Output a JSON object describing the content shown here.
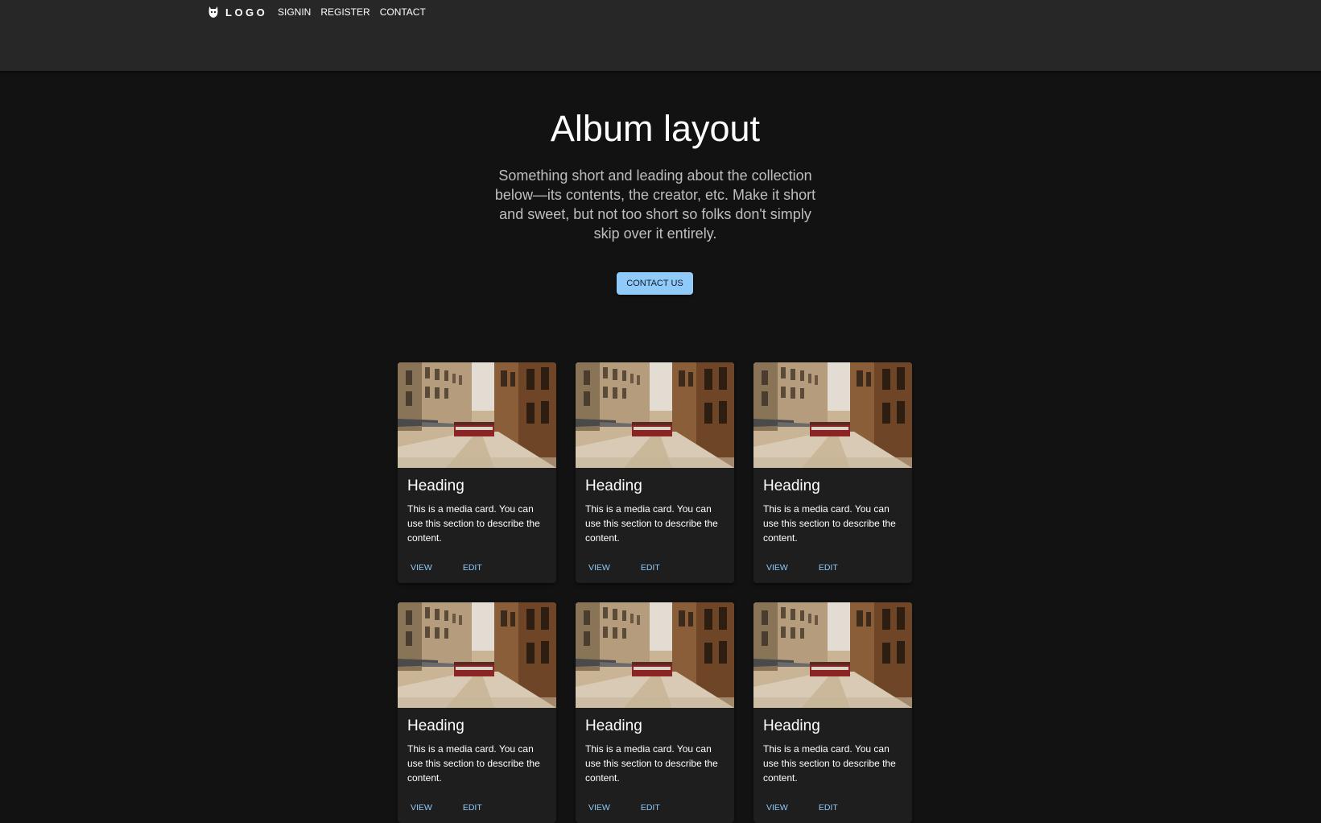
{
  "appbar": {
    "logo_text": "LOGO",
    "nav": [
      {
        "label": "SIGNIN"
      },
      {
        "label": "REGISTER"
      },
      {
        "label": "CONTACT"
      }
    ]
  },
  "hero": {
    "title": "Album layout",
    "subtitle": "Something short and leading about the collection below—its contents, the creator, etc. Make it short and sweet, but not too short so folks don't simply skip over it entirely.",
    "button_label": "CONTACT US"
  },
  "cards": [
    {
      "heading": "Heading",
      "text": "This is a media card. You can use this section to describe the content.",
      "view": "VIEW",
      "edit": "EDIT"
    },
    {
      "heading": "Heading",
      "text": "This is a media card. You can use this section to describe the content.",
      "view": "VIEW",
      "edit": "EDIT"
    },
    {
      "heading": "Heading",
      "text": "This is a media card. You can use this section to describe the content.",
      "view": "VIEW",
      "edit": "EDIT"
    },
    {
      "heading": "Heading",
      "text": "This is a media card. You can use this section to describe the content.",
      "view": "VIEW",
      "edit": "EDIT"
    },
    {
      "heading": "Heading",
      "text": "This is a media card. You can use this section to describe the content.",
      "view": "VIEW",
      "edit": "EDIT"
    },
    {
      "heading": "Heading",
      "text": "This is a media card. You can use this section to describe the content.",
      "view": "VIEW",
      "edit": "EDIT"
    }
  ],
  "colors": {
    "background": "#121212",
    "appbar": "#272727",
    "card": "#1e1e1e",
    "accent": "#90caf9"
  },
  "icons": {
    "logo": "mask-icon"
  }
}
